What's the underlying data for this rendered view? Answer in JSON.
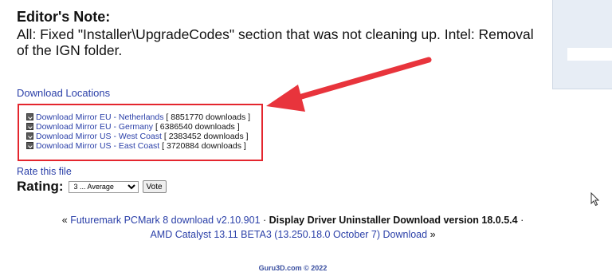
{
  "editor": {
    "title": "Editor's Note:",
    "body": "All: Fixed \"Installer\\UpgradeCodes\" section that was not cleaning up. Intel: Removal of the IGN folder."
  },
  "download_locations": "Download Locations",
  "mirrors": [
    {
      "label": "Download Mirror EU - Netherlands",
      "count": "[ 8851770 downloads ]"
    },
    {
      "label": "Download Mirror EU - Germany",
      "count": "[ 6386540 downloads ]"
    },
    {
      "label": "Download Mirror US - West Coast",
      "count": "[ 2383452 downloads ]"
    },
    {
      "label": "Download Mirror US - East Coast",
      "count": "[ 3720884 downloads ]"
    }
  ],
  "rating": {
    "rate_link": "Rate this file",
    "label": "Rating:",
    "selected": "3 ... Average",
    "vote": "Vote"
  },
  "nav": {
    "prev_arrow": "«",
    "prev": "Futuremark PCMark 8 download v2.10.901",
    "sep1": "·",
    "current": "Display Driver Uninstaller Download version 18.0.5.4",
    "sep2": "·",
    "next": "AMD Catalyst 13.11 BETA3 (13.250.18.0 October 7) Download",
    "next_arrow": "»"
  },
  "footer": "Guru3D.com © 2022",
  "colors": {
    "link": "#2a3fa8",
    "highlight_box": "#e4262e",
    "arrow": "#e8343c",
    "side_panel": "#e7edf5"
  }
}
